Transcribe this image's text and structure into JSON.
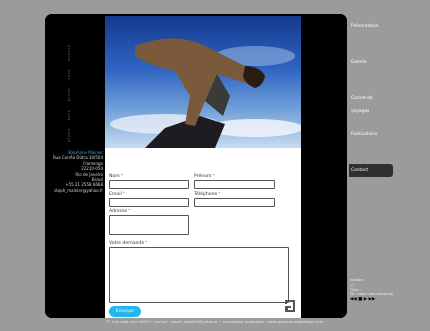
{
  "sidebar_vertical_text": "alpha · beta · grand · nord · ecosse",
  "address": {
    "name": "Stéphane Mainier",
    "lines": [
      "Rua Corrêa Dûtra 30/504",
      "Flamengo",
      "22210-050",
      "Rio de Janeiro",
      "Brasil",
      "+55 21 2558 6668",
      "steph_mainier@yahoo.fr"
    ]
  },
  "form": {
    "nom_label": "Nom",
    "prenom_label": "Prénom",
    "email_label": "Email",
    "telephone_label": "Téléphone",
    "adresse_label": "Adresse",
    "demande_label": "Votre demande",
    "required_marker": "*",
    "send_label": "Envoyer"
  },
  "nav": {
    "items": [
      {
        "label": "Présentation",
        "active": false
      },
      {
        "label": "Galerie",
        "active": false
      },
      {
        "label": "Carnet de voyages",
        "active": false
      },
      {
        "label": "Publications",
        "active": false
      },
      {
        "label": "Contact",
        "active": true
      }
    ]
  },
  "player": {
    "artist_label": "Artiste :",
    "artist_value": "-/-",
    "title_label": "Titre :",
    "title_value": "Dr. Lotto look aussieus",
    "controls": "◀◀ ■ ▶ ▶▶"
  },
  "footer": {
    "text": "© ride-shot.com  2005   •   contact : steph_mainier@yahoo.fr   •   conception graphique : www.gemma-webdesign.com"
  },
  "colors": {
    "page_bg": "#9b9b9b",
    "frame": "#000000",
    "accent": "#20b8ee",
    "active_nav": "#2f2f2f"
  }
}
